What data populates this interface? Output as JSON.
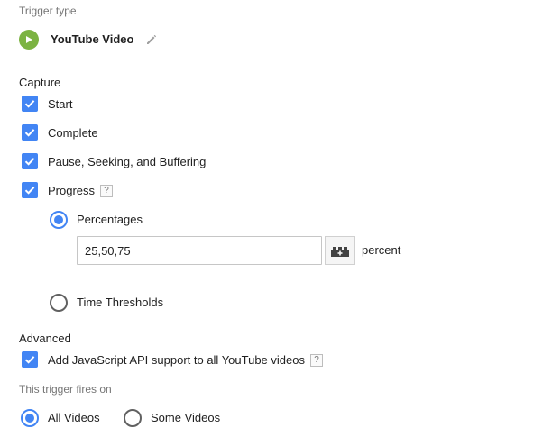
{
  "trigger_type": {
    "section_label": "Trigger type",
    "name": "YouTube Video",
    "icon": "play-icon",
    "edit_icon": "pencil-icon",
    "accent": "#7cb342"
  },
  "capture": {
    "heading": "Capture",
    "options": [
      {
        "label": "Start",
        "checked": true
      },
      {
        "label": "Complete",
        "checked": true
      },
      {
        "label": "Pause, Seeking, and Buffering",
        "checked": true
      },
      {
        "label": "Progress",
        "checked": true,
        "help": "?"
      }
    ],
    "progress": {
      "percentages_label": "Percentages",
      "percentages_selected": true,
      "percentages_value": "25,50,75",
      "variable_icon": "lego-brick-icon",
      "suffix": "percent",
      "time_thresholds_label": "Time Thresholds",
      "time_thresholds_selected": false
    }
  },
  "advanced": {
    "heading": "Advanced",
    "js_api_label": "Add JavaScript API support to all YouTube videos",
    "js_api_checked": true,
    "help": "?"
  },
  "fires_on": {
    "section_label": "This trigger fires on",
    "options": [
      {
        "label": "All Videos",
        "selected": true
      },
      {
        "label": "Some Videos",
        "selected": false
      }
    ]
  },
  "colors": {
    "primary": "#4285f4",
    "muted_text": "#757575"
  }
}
